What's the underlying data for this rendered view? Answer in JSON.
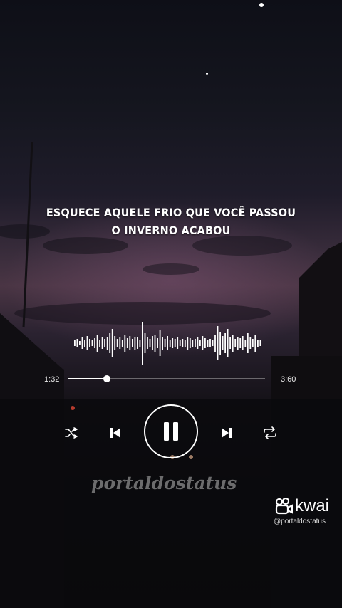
{
  "lyrics": {
    "line1": "ESQUECE AQUELE FRIO QUE VOCÊ PASSOU",
    "line2": "O INVERNO ACABOU"
  },
  "player": {
    "elapsed": "1:32",
    "duration": "3:60",
    "progress_fraction": 0.2,
    "state": "playing"
  },
  "icons": {
    "shuffle": "shuffle-icon",
    "previous": "skip-previous-icon",
    "play_pause": "pause-icon",
    "next": "skip-next-icon",
    "repeat": "repeat-icon"
  },
  "watermark": "portaldostatus",
  "kwai": {
    "brand": "kwai",
    "handle": "@portaldostatus"
  },
  "colors": {
    "text": "#ffffff",
    "watermark": "#bebebe"
  }
}
